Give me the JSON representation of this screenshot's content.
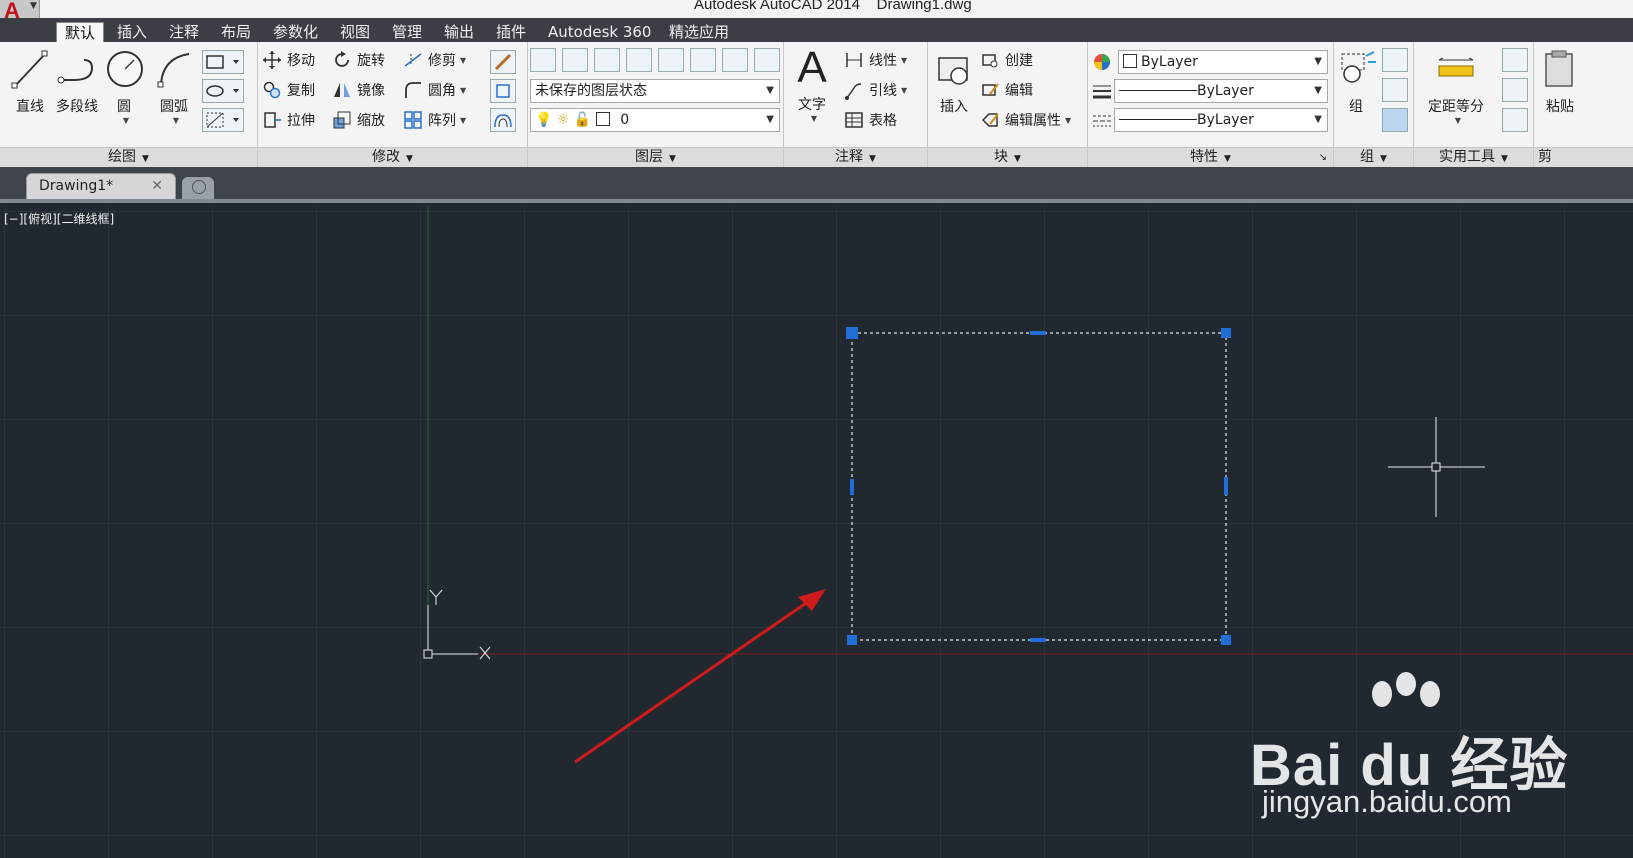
{
  "window": {
    "title": "Autodesk AutoCAD 2014    Drawing1.dwg",
    "app_logo": "A"
  },
  "menu_tabs": [
    "默认",
    "插入",
    "注释",
    "布局",
    "参数化",
    "视图",
    "管理",
    "输出",
    "插件",
    "Autodesk 360",
    "精选应用"
  ],
  "active_tab": "默认",
  "ribbon": {
    "draw": {
      "title": "绘图",
      "line": "直线",
      "polyline": "多段线",
      "circle": "圆",
      "arc": "圆弧"
    },
    "modify": {
      "title": "修改",
      "move": "移动",
      "rotate": "旋转",
      "trim": "修剪",
      "copy": "复制",
      "mirror": "镜像",
      "fillet": "圆角",
      "stretch": "拉伸",
      "scale": "缩放",
      "array": "阵列"
    },
    "layers": {
      "title": "图层",
      "layer_state": "未保存的图层状态",
      "current_layer": "0"
    },
    "annotation": {
      "title": "注释",
      "text": "文字",
      "linear": "线性",
      "leader": "引线",
      "table": "表格"
    },
    "block": {
      "title": "块",
      "insert": "插入",
      "create": "创建",
      "edit": "编辑",
      "edit_attributes": "编辑属性"
    },
    "properties": {
      "title": "特性",
      "color": "ByLayer",
      "linetype": "ByLayer",
      "lineweight": "ByLayer"
    },
    "groups": {
      "title": "组",
      "group": "组"
    },
    "utilities": {
      "title": "实用工具",
      "measure": "定距等分"
    },
    "clipboard": {
      "paste": "粘贴",
      "title_partial": "剪"
    }
  },
  "file_tab": {
    "name": "Drawing1*",
    "close": "✕"
  },
  "canvas": {
    "view_label": "[−][俯视][二维线框]",
    "ucs_x": "X",
    "ucs_y": "Y"
  },
  "watermark": {
    "brand": "Bai du 经验",
    "url": "jingyan.baidu.com"
  },
  "colors": {
    "canvas_bg": "#212830",
    "grip": "#1f6fd6",
    "arrow": "#d11a1a",
    "x_axis": "#7a1f1f",
    "y_axis": "#1f6b2a"
  }
}
